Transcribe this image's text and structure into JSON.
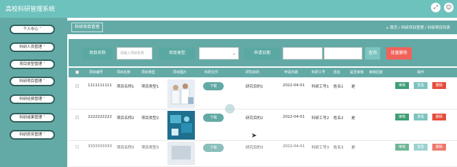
{
  "app": {
    "title": "高校科研管理系统"
  },
  "topbar": {
    "expand_icon": "expand-icon",
    "user_icon": "user-icon"
  },
  "sidebar": {
    "items": [
      {
        "label": "个人中心"
      },
      {
        "label": "科研人员管理"
      },
      {
        "label": "项目类型管理"
      },
      {
        "label": "科研项目管理"
      },
      {
        "label": "科研经费管理"
      },
      {
        "label": "科研成果管理"
      },
      {
        "label": "科研获奖管理"
      }
    ]
  },
  "breadcrumb": {
    "tab": "科研项目管理",
    "path": "首页 / 科研项目管理 / 科研项目列表"
  },
  "search": {
    "name_label": "项目名称",
    "name_placeholder": "请输入项目名称",
    "type_label": "项目类型",
    "type_value": "",
    "date_label": "申请日期",
    "date_start_placeholder": "",
    "date_end_placeholder": "",
    "search_button": "查询",
    "batch_delete_button": "批量删除"
  },
  "table": {
    "headers": [
      "项目编号",
      "项目名称",
      "项目类型",
      "项目图片",
      "科研文件",
      "研究目的",
      "申请日期",
      "科研工号",
      "姓名",
      "是否审核",
      "审核回复",
      "操作"
    ],
    "rows": [
      {
        "code": "1111111111",
        "name": "项目名称1",
        "type": "项目类型1",
        "file": "下载",
        "purpose": "研究目的1",
        "date": "2022-04-01",
        "staff_no": "科研工号1",
        "person": "姓名1",
        "reviewed": "是",
        "reply": ""
      },
      {
        "code": "2222222222",
        "name": "项目名称2",
        "type": "项目类型2",
        "file": "下载",
        "purpose": "研究目的2",
        "date": "2022-04-01",
        "staff_no": "科研工号2",
        "person": "姓名2",
        "reviewed": "是",
        "reply": ""
      },
      {
        "code": "3333333333",
        "name": "项目名称3",
        "type": "项目类型3",
        "file": "下载",
        "purpose": "研究目的3",
        "date": "2022-04-01",
        "staff_no": "科研工号3",
        "person": "姓名3",
        "reviewed": "是",
        "reply": ""
      }
    ],
    "actions": {
      "review": "审核",
      "view": "查看",
      "delete": "删除"
    }
  },
  "colors": {
    "accent": "#63aaa6",
    "topbar": "#6ec2bd",
    "review": "#3f9e75",
    "delete": "#e74c3c"
  }
}
